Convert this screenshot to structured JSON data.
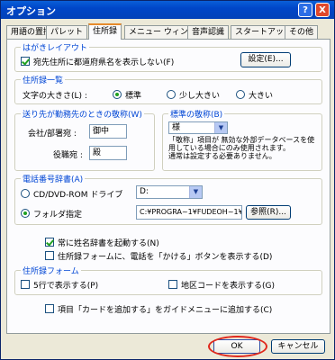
{
  "window": {
    "title": "オプション",
    "help_label": "?",
    "close_label": "X"
  },
  "tabs": [
    {
      "label": "用語の置換"
    },
    {
      "label": "パレット"
    },
    {
      "label": "住所録"
    },
    {
      "label": "メニュー ウィンドウ"
    },
    {
      "label": "音声認識"
    },
    {
      "label": "スタートアップ"
    },
    {
      "label": "その他"
    }
  ],
  "hagaki": {
    "title": "はがきレイアウト",
    "checkbox_label": "宛先住所に都道府県名を表示しない(F)",
    "checked": true,
    "settings_button": "設定(E)..."
  },
  "address_list": {
    "title": "住所録一覧",
    "font_size_label": "文字の大きさ(L) :",
    "options": [
      "標準",
      "少し大きい",
      "大きい"
    ],
    "selected": "標準"
  },
  "honorific_workplace": {
    "title": "送り先が勤務先のときの敬称(W)",
    "company_label": "会社/部署宛 :",
    "company_value": "御中",
    "position_label": "役職宛 :",
    "position_value": "殿"
  },
  "honorific_standard": {
    "title": "標準の敬称(B)",
    "select_value": "様",
    "note": "「敬称」項目が 無効な外部データベースを使用している場合にのみ使用されます。\n通常は設定する必要ありません。"
  },
  "phone_dict": {
    "title": "電話番号辞書(A)",
    "cd_label": "CD/DVD-ROM ドライブ",
    "drive_value": "D:",
    "folder_label": "フォルダ指定",
    "folder_value": "C:¥PROGRA~1¥FUDEOH~1¥CDRON",
    "browse_button": "参照(R)...",
    "selected": "folder"
  },
  "options": {
    "name_dict_label": "常に姓名辞書を起動する(N)",
    "name_dict_checked": true,
    "phone_button_label": "住所録フォームに、電話を「かける」ボタンを表示する(D)",
    "phone_button_checked": false
  },
  "address_form": {
    "title": "住所録フォーム",
    "row5_label": "5行で表示する(P)",
    "row5_checked": false,
    "region_label": "地区コードを表示する(G)",
    "region_checked": false
  },
  "guide_menu": {
    "label": "項目「カードを追加する」をガイドメニューに追加する(C)",
    "checked": false
  },
  "buttons": {
    "ok": "OK",
    "cancel": "キャンセル"
  }
}
